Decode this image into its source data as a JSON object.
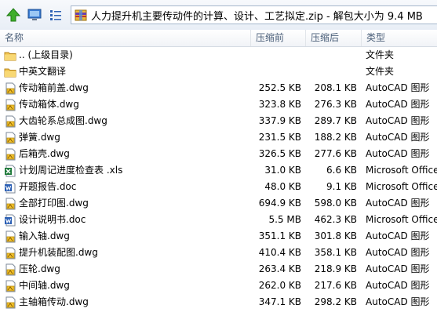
{
  "toolbar": {
    "path": "人力提升机主要传动件的计算、设计、工艺拟定.zip - 解包大小为 9.4 MB"
  },
  "columns": {
    "name": "名称",
    "size": "压缩前",
    "compressed": "压缩后",
    "type": "类型"
  },
  "rows": [
    {
      "name": ".. (上级目录)",
      "size": "",
      "compressed": "",
      "type": "文件夹",
      "icon": "folder-up-icon"
    },
    {
      "name": "中英文翻译",
      "size": "",
      "compressed": "",
      "type": "文件夹",
      "icon": "folder-icon"
    },
    {
      "name": "传动箱前盖.dwg",
      "size": "252.5 KB",
      "compressed": "208.1 KB",
      "type": "AutoCAD 图形",
      "icon": "dwg-file-icon"
    },
    {
      "name": "传动箱体.dwg",
      "size": "323.8 KB",
      "compressed": "276.3 KB",
      "type": "AutoCAD 图形",
      "icon": "dwg-file-icon"
    },
    {
      "name": "大齿轮系总成图.dwg",
      "size": "337.9 KB",
      "compressed": "289.7 KB",
      "type": "AutoCAD 图形",
      "icon": "dwg-file-icon"
    },
    {
      "name": "弹簧.dwg",
      "size": "231.5 KB",
      "compressed": "188.2 KB",
      "type": "AutoCAD 图形",
      "icon": "dwg-file-icon"
    },
    {
      "name": "后箱壳.dwg",
      "size": "326.5 KB",
      "compressed": "277.6 KB",
      "type": "AutoCAD 图形",
      "icon": "dwg-file-icon"
    },
    {
      "name": "计划周记进度检查表 .xls",
      "size": "31.0 KB",
      "compressed": "6.6 KB",
      "type": "Microsoft Office",
      "icon": "xls-file-icon"
    },
    {
      "name": "开题报告.doc",
      "size": "48.0 KB",
      "compressed": "9.1 KB",
      "type": "Microsoft Office",
      "icon": "doc-file-icon"
    },
    {
      "name": "全部打印图.dwg",
      "size": "694.9 KB",
      "compressed": "598.0 KB",
      "type": "AutoCAD 图形",
      "icon": "dwg-file-icon"
    },
    {
      "name": "设计说明书.doc",
      "size": "5.5 MB",
      "compressed": "462.3 KB",
      "type": "Microsoft Office",
      "icon": "doc-file-icon"
    },
    {
      "name": "输入轴.dwg",
      "size": "351.1 KB",
      "compressed": "301.8 KB",
      "type": "AutoCAD 图形",
      "icon": "dwg-file-icon"
    },
    {
      "name": "提升机装配图.dwg",
      "size": "410.4 KB",
      "compressed": "358.1 KB",
      "type": "AutoCAD 图形",
      "icon": "dwg-file-icon"
    },
    {
      "name": "压轮.dwg",
      "size": "263.4 KB",
      "compressed": "218.9 KB",
      "type": "AutoCAD 图形",
      "icon": "dwg-file-icon"
    },
    {
      "name": "中间轴.dwg",
      "size": "262.0 KB",
      "compressed": "217.6 KB",
      "type": "AutoCAD 图形",
      "icon": "dwg-file-icon"
    },
    {
      "name": "主轴箱传动.dwg",
      "size": "347.1 KB",
      "compressed": "298.2 KB",
      "type": "AutoCAD 图形",
      "icon": "dwg-file-icon"
    }
  ]
}
